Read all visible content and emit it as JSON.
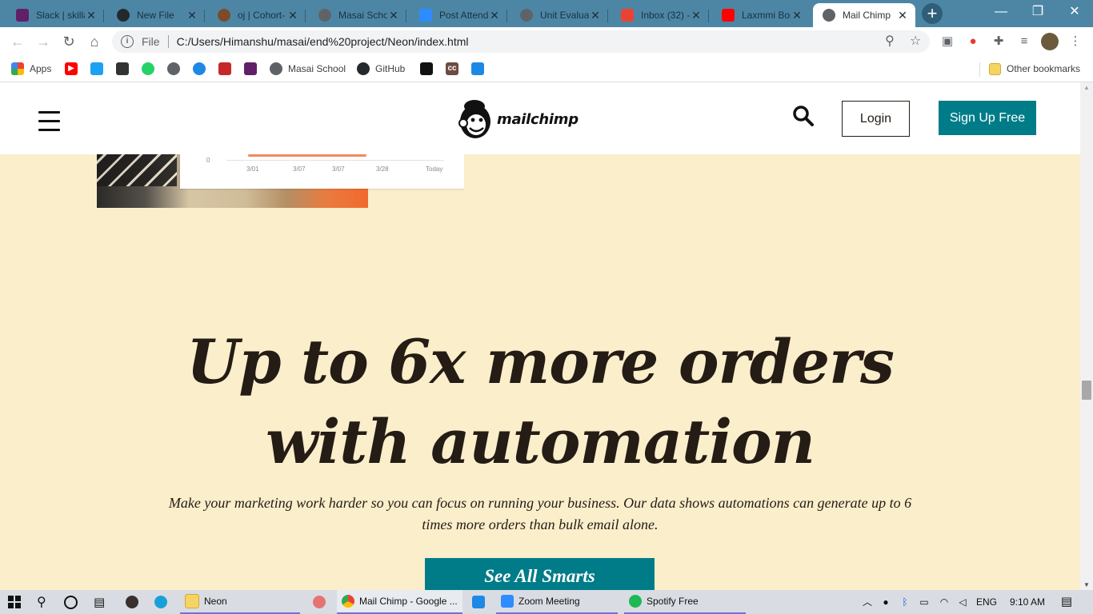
{
  "browser": {
    "tabs": [
      {
        "title": "Slack | skillathon",
        "favicon_color": "#611f69"
      },
      {
        "title": "New File",
        "favicon_color": "#24292e"
      },
      {
        "title": "oj | Cohort-",
        "favicon_color": "#7b4b2a"
      },
      {
        "title": "Masai School",
        "favicon_color": "#5f6368"
      },
      {
        "title": "Post Attendance",
        "favicon_color": "#2d8cff"
      },
      {
        "title": "Unit Evaluation",
        "favicon_color": "#5f6368"
      },
      {
        "title": "Inbox (32) - ",
        "favicon_color": "#ea4335"
      },
      {
        "title": "Laxmmi Bomb",
        "favicon_color": "#ff0000"
      },
      {
        "title": "Mail Chimp",
        "favicon_color": "#5f6368",
        "active": true
      }
    ],
    "close_glyph": "✕",
    "new_tab_glyph": "+",
    "window_controls": {
      "minimize": "—",
      "restore": "❐",
      "close": "✕"
    },
    "address": {
      "scheme_label": "File",
      "url": "C:/Users/Himanshu/masai/end%20project/Neon/index.html"
    },
    "bookmarks": [
      {
        "label": "Apps",
        "icon": "apps-grid-icon"
      },
      {
        "label": "",
        "icon": "youtube-icon"
      },
      {
        "label": "",
        "icon": "twitter-icon"
      },
      {
        "label": "",
        "icon": "calc-icon"
      },
      {
        "label": "",
        "icon": "whatsapp-icon"
      },
      {
        "label": "",
        "icon": "globe-icon"
      },
      {
        "label": "",
        "icon": "bird-icon"
      },
      {
        "label": "",
        "icon": "medal-icon"
      },
      {
        "label": "",
        "icon": "slack-icon"
      },
      {
        "label": "Masai School",
        "icon": "globe-icon"
      },
      {
        "label": "GitHub",
        "icon": "github-icon"
      },
      {
        "label": "",
        "icon": "codepen-icon"
      },
      {
        "label": "",
        "icon": "cc-icon"
      },
      {
        "label": "",
        "icon": "flag-icon"
      }
    ],
    "other_bookmarks_label": "Other bookmarks"
  },
  "site": {
    "brand": "mailchimp",
    "nav": {
      "login_label": "Login",
      "signup_label": "Sign Up Free"
    },
    "hero_chart": {
      "zero_label": "0",
      "tick_labels": [
        "3/01",
        "3/07",
        "3/07",
        "3/28",
        "Today"
      ]
    },
    "headline_line1": "Up to 6x more orders",
    "headline_line2": "with automation",
    "subtext": "Make your marketing work harder so you can focus on running your business. Our data shows automations can generate up to 6 times more orders than bulk email alone.",
    "cta_label": "See All Smarts",
    "colors": {
      "background": "#fbeecb",
      "accent": "#007c89",
      "text": "#241c15"
    }
  },
  "taskbar": {
    "apps": [
      {
        "label": "Neon",
        "icon": "folder-icon"
      },
      {
        "label": "",
        "icon": "paint-icon"
      },
      {
        "label": "Mail Chimp - Google ...",
        "icon": "chrome-icon"
      },
      {
        "label": "",
        "icon": "vscode-icon"
      },
      {
        "label": "Zoom Meeting",
        "icon": "zoom-icon"
      },
      {
        "label": "Spotify Free",
        "icon": "spotify-icon"
      }
    ],
    "language": "ENG",
    "time": "9:10 AM"
  }
}
